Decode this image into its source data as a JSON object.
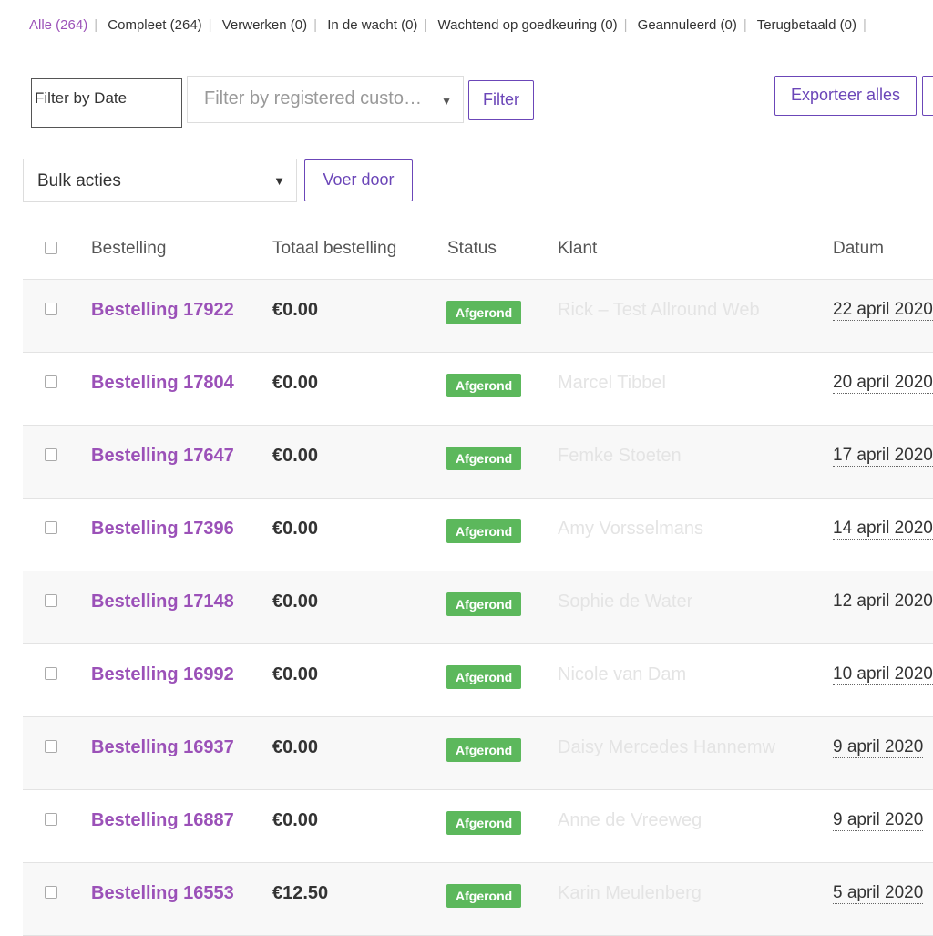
{
  "status_filters": [
    {
      "label": "Alle (264)",
      "current": true
    },
    {
      "label": "Compleet (264)",
      "current": false
    },
    {
      "label": "Verwerken (0)",
      "current": false
    },
    {
      "label": "In de wacht (0)",
      "current": false
    },
    {
      "label": "Wachtend op goedkeuring (0)",
      "current": false
    },
    {
      "label": "Geannuleerd (0)",
      "current": false
    },
    {
      "label": "Terugbetaald (0)",
      "current": false
    }
  ],
  "filters": {
    "date_placeholder": "Filter by Date",
    "customer_placeholder": "Filter by registered custo…",
    "filter_button": "Filter",
    "export_button": "Exporteer alles"
  },
  "bulk": {
    "select_label": "Bulk acties",
    "apply_button": "Voer door"
  },
  "table": {
    "headers": {
      "order": "Bestelling",
      "total": "Totaal bestelling",
      "status": "Status",
      "customer": "Klant",
      "date": "Datum"
    },
    "rows": [
      {
        "order": "Bestelling 17922",
        "total": "€0.00",
        "status": "Afgerond",
        "customer": "Rick – Test Allround Web",
        "date": "22 april 2020"
      },
      {
        "order": "Bestelling 17804",
        "total": "€0.00",
        "status": "Afgerond",
        "customer": "Marcel Tibbel",
        "date": "20 april 2020"
      },
      {
        "order": "Bestelling 17647",
        "total": "€0.00",
        "status": "Afgerond",
        "customer": "Femke Stoeten",
        "date": "17 april 2020"
      },
      {
        "order": "Bestelling 17396",
        "total": "€0.00",
        "status": "Afgerond",
        "customer": "Amy Vorsselmans",
        "date": "14 april 2020"
      },
      {
        "order": "Bestelling 17148",
        "total": "€0.00",
        "status": "Afgerond",
        "customer": "Sophie de Water",
        "date": "12 april 2020"
      },
      {
        "order": "Bestelling 16992",
        "total": "€0.00",
        "status": "Afgerond",
        "customer": "Nicole van Dam",
        "date": "10 april 2020"
      },
      {
        "order": "Bestelling 16937",
        "total": "€0.00",
        "status": "Afgerond",
        "customer": "Daisy Mercedes Hannemw",
        "date": "9 april 2020"
      },
      {
        "order": "Bestelling 16887",
        "total": "€0.00",
        "status": "Afgerond",
        "customer": "Anne de Vreeweg",
        "date": "9 april 2020"
      },
      {
        "order": "Bestelling 16553",
        "total": "€12.50",
        "status": "Afgerond",
        "customer": "Karin Meulenberg",
        "date": "5 april 2020"
      }
    ]
  },
  "colors": {
    "accent": "#9b51b8",
    "button": "#6b46b8",
    "status_complete": "#5cb85c"
  }
}
